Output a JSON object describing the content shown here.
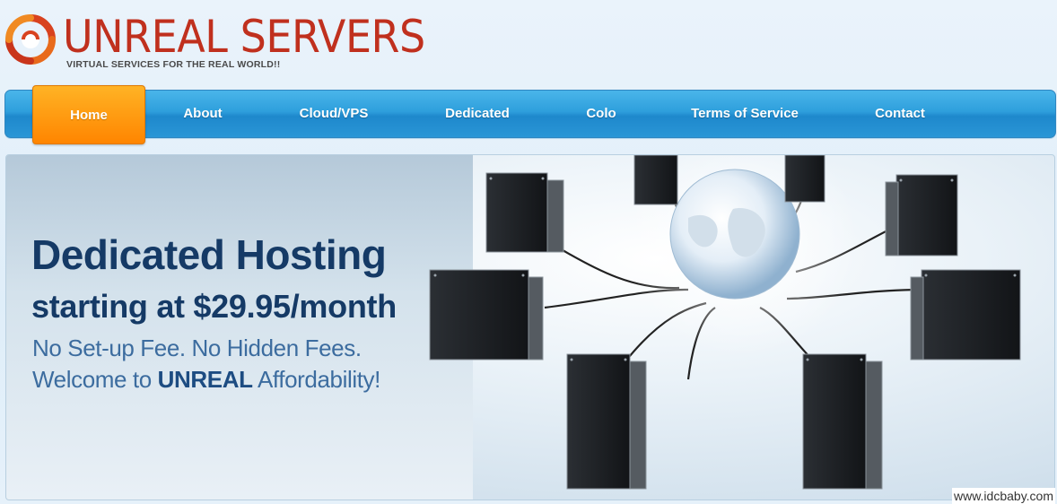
{
  "brand": {
    "name": "UNREAL SERVERS",
    "tagline": "VIRTUAL SERVICES FOR THE REAL WORLD!!",
    "color": "#c0301e",
    "logo_icon": "swirl-logo-icon"
  },
  "nav": {
    "items": [
      {
        "label": "Home",
        "active": true
      },
      {
        "label": "About"
      },
      {
        "label": "Cloud/VPS"
      },
      {
        "label": "Dedicated"
      },
      {
        "label": "Colo"
      },
      {
        "label": "Terms of Service"
      },
      {
        "label": "Contact"
      }
    ],
    "bar_color": "#2a96d6",
    "active_color": "#ff9c12"
  },
  "banner": {
    "headline": "Dedicated Hosting",
    "subheadline": "starting at $29.95/month",
    "line1": "No Set-up Fee. No Hidden Fees.",
    "line2_prefix": "Welcome to ",
    "line2_bold": "UNREAL",
    "line2_suffix": " Affordability!",
    "image": "servers-connected-to-globe-illustration"
  },
  "watermark": "www.idcbaby.com"
}
